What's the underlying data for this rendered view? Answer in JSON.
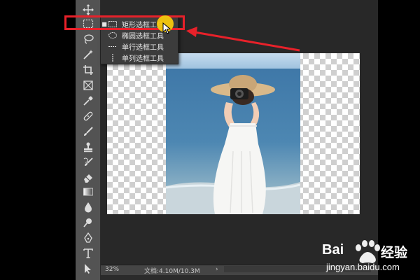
{
  "toolbar": {
    "tools": [
      {
        "icon": "move-icon"
      },
      {
        "icon": "rectangular-marquee-icon"
      },
      {
        "icon": "lasso-icon"
      },
      {
        "icon": "magic-wand-icon"
      },
      {
        "icon": "crop-icon"
      },
      {
        "icon": "frame-icon"
      },
      {
        "icon": "eyedropper-icon"
      },
      {
        "icon": "healing-brush-icon"
      },
      {
        "icon": "brush-icon"
      },
      {
        "icon": "clone-stamp-icon"
      },
      {
        "icon": "history-brush-icon"
      },
      {
        "icon": "eraser-icon"
      },
      {
        "icon": "gradient-icon"
      },
      {
        "icon": "blur-icon"
      },
      {
        "icon": "dodge-icon"
      },
      {
        "icon": "pen-icon"
      },
      {
        "icon": "type-icon"
      },
      {
        "icon": "path-selection-icon"
      }
    ]
  },
  "flyout": {
    "items": [
      {
        "label": "矩形选框工具",
        "icon": "rectangular-marquee-icon",
        "active": true
      },
      {
        "label": "椭圆选框工具",
        "icon": "elliptical-marquee-icon",
        "active": false
      },
      {
        "label": "单行选框工具",
        "icon": "single-row-marquee-icon",
        "active": false
      },
      {
        "label": "单列选框工具",
        "icon": "single-column-marquee-icon",
        "active": false
      }
    ],
    "bullet": "■"
  },
  "status": {
    "zoom": "32%",
    "doc": "文档:4.10M/10.3M",
    "arrow": "›"
  },
  "watermark": {
    "brand_en": "Bai",
    "brand_cn": "经验",
    "url": "jingyan.baidu.com"
  },
  "colors": {
    "highlight": "#e8212a",
    "cursor_dot": "#f7c90d"
  }
}
